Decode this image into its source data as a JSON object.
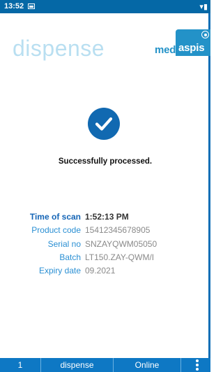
{
  "status_bar": {
    "time": "13:52"
  },
  "header": {
    "title": "dispense",
    "logo_med": "med",
    "logo_aspis": "aspis"
  },
  "result": {
    "message": "Successfully processed."
  },
  "details": {
    "time_of_scan": {
      "label": "Time of scan",
      "value": "1:52:13 PM"
    },
    "product_code": {
      "label": "Product code",
      "value": "15412345678905"
    },
    "serial_no": {
      "label": "Serial no",
      "value": "SNZAYQWM05050"
    },
    "batch": {
      "label": "Batch",
      "value": "LT150.ZAY-QWM/I"
    },
    "expiry_date": {
      "label": "Expiry date",
      "value": "09.2021"
    }
  },
  "bottom_bar": {
    "count": "1",
    "mode": "dispense",
    "status": "Online"
  },
  "colors": {
    "primary": "#0e78c4",
    "accent": "#2a8fd3",
    "title_tint": "#b9dff1"
  }
}
